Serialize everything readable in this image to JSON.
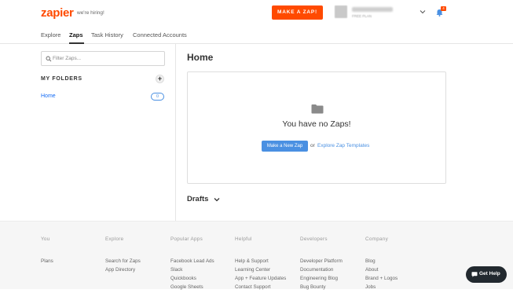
{
  "header": {
    "logo": "zapier",
    "hiring": "we're hiring!",
    "make_zap": "MAKE A ZAP!",
    "user_plan": "FREE PLAN",
    "notification_count": "4"
  },
  "tabs": [
    "Explore",
    "Zaps",
    "Task History",
    "Connected Accounts"
  ],
  "active_tab": "Zaps",
  "sidebar": {
    "filter_placeholder": "Filter Zaps...",
    "folders_title": "MY FOLDERS",
    "add_icon": "plus-icon",
    "folders": [
      {
        "label": "Home",
        "count": "0"
      }
    ]
  },
  "main": {
    "title": "Home",
    "empty_text": "You have no Zaps!",
    "new_zap_button": "Make a New Zap",
    "or_text": "or",
    "templates_link": "Explore Zap Templates",
    "drafts": "Drafts"
  },
  "footer": {
    "columns": [
      {
        "heading": "You",
        "links": [
          "Plans"
        ]
      },
      {
        "heading": "Explore",
        "links": [
          "Search for Zaps",
          "App Directory"
        ]
      },
      {
        "heading": "Popular Apps",
        "links": [
          "Facebook Lead Ads",
          "Slack",
          "Quickbooks",
          "Google Sheets"
        ]
      },
      {
        "heading": "Helpful",
        "links": [
          "Help & Support",
          "Learning Center",
          "App + Feature Updates",
          "Contact Support"
        ]
      },
      {
        "heading": "Developers",
        "links": [
          "Developer Platform",
          "Documentation",
          "Engineering Blog",
          "Bug Bounty"
        ]
      },
      {
        "heading": "Company",
        "links": [
          "Blog",
          "About",
          "Brand + Logos",
          "Jobs"
        ]
      }
    ]
  },
  "get_help": "Get Help",
  "colors": {
    "brand": "#ff4a00",
    "link": "#136bf5",
    "button_blue": "#4a90e2"
  }
}
